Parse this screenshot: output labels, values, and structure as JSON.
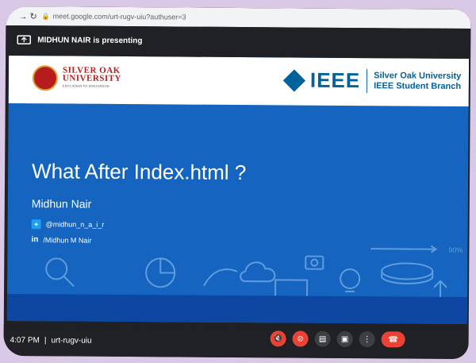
{
  "browser": {
    "url": "meet.google.com/urt-rugv-uiu?authuser=3"
  },
  "meet": {
    "presenting_text": "MIDHUN NAIR is presenting",
    "time": "4:07 PM",
    "meeting_code": "urt-rugv-uiu"
  },
  "slide": {
    "sou_line1": "SILVER OAK",
    "sou_line2": "UNIVERSITY",
    "sou_line3": "EDUCATION TO INNOVATION",
    "ieee_word": "IEEE",
    "ieee_branch_line1": "Silver Oak University",
    "ieee_branch_line2": "IEEE Student Branch",
    "title": "What After Index.html ?",
    "presenter": "Midhun Nair",
    "twitter_handle": "@midhun_n_a_i_r",
    "linkedin_handle": "/Midhun M Nair",
    "deco_text": "90%"
  },
  "colors": {
    "slide_blue": "#1565c0",
    "ieee_blue": "#00629b",
    "sou_red": "#b71c1c",
    "meet_red": "#ea4335"
  }
}
